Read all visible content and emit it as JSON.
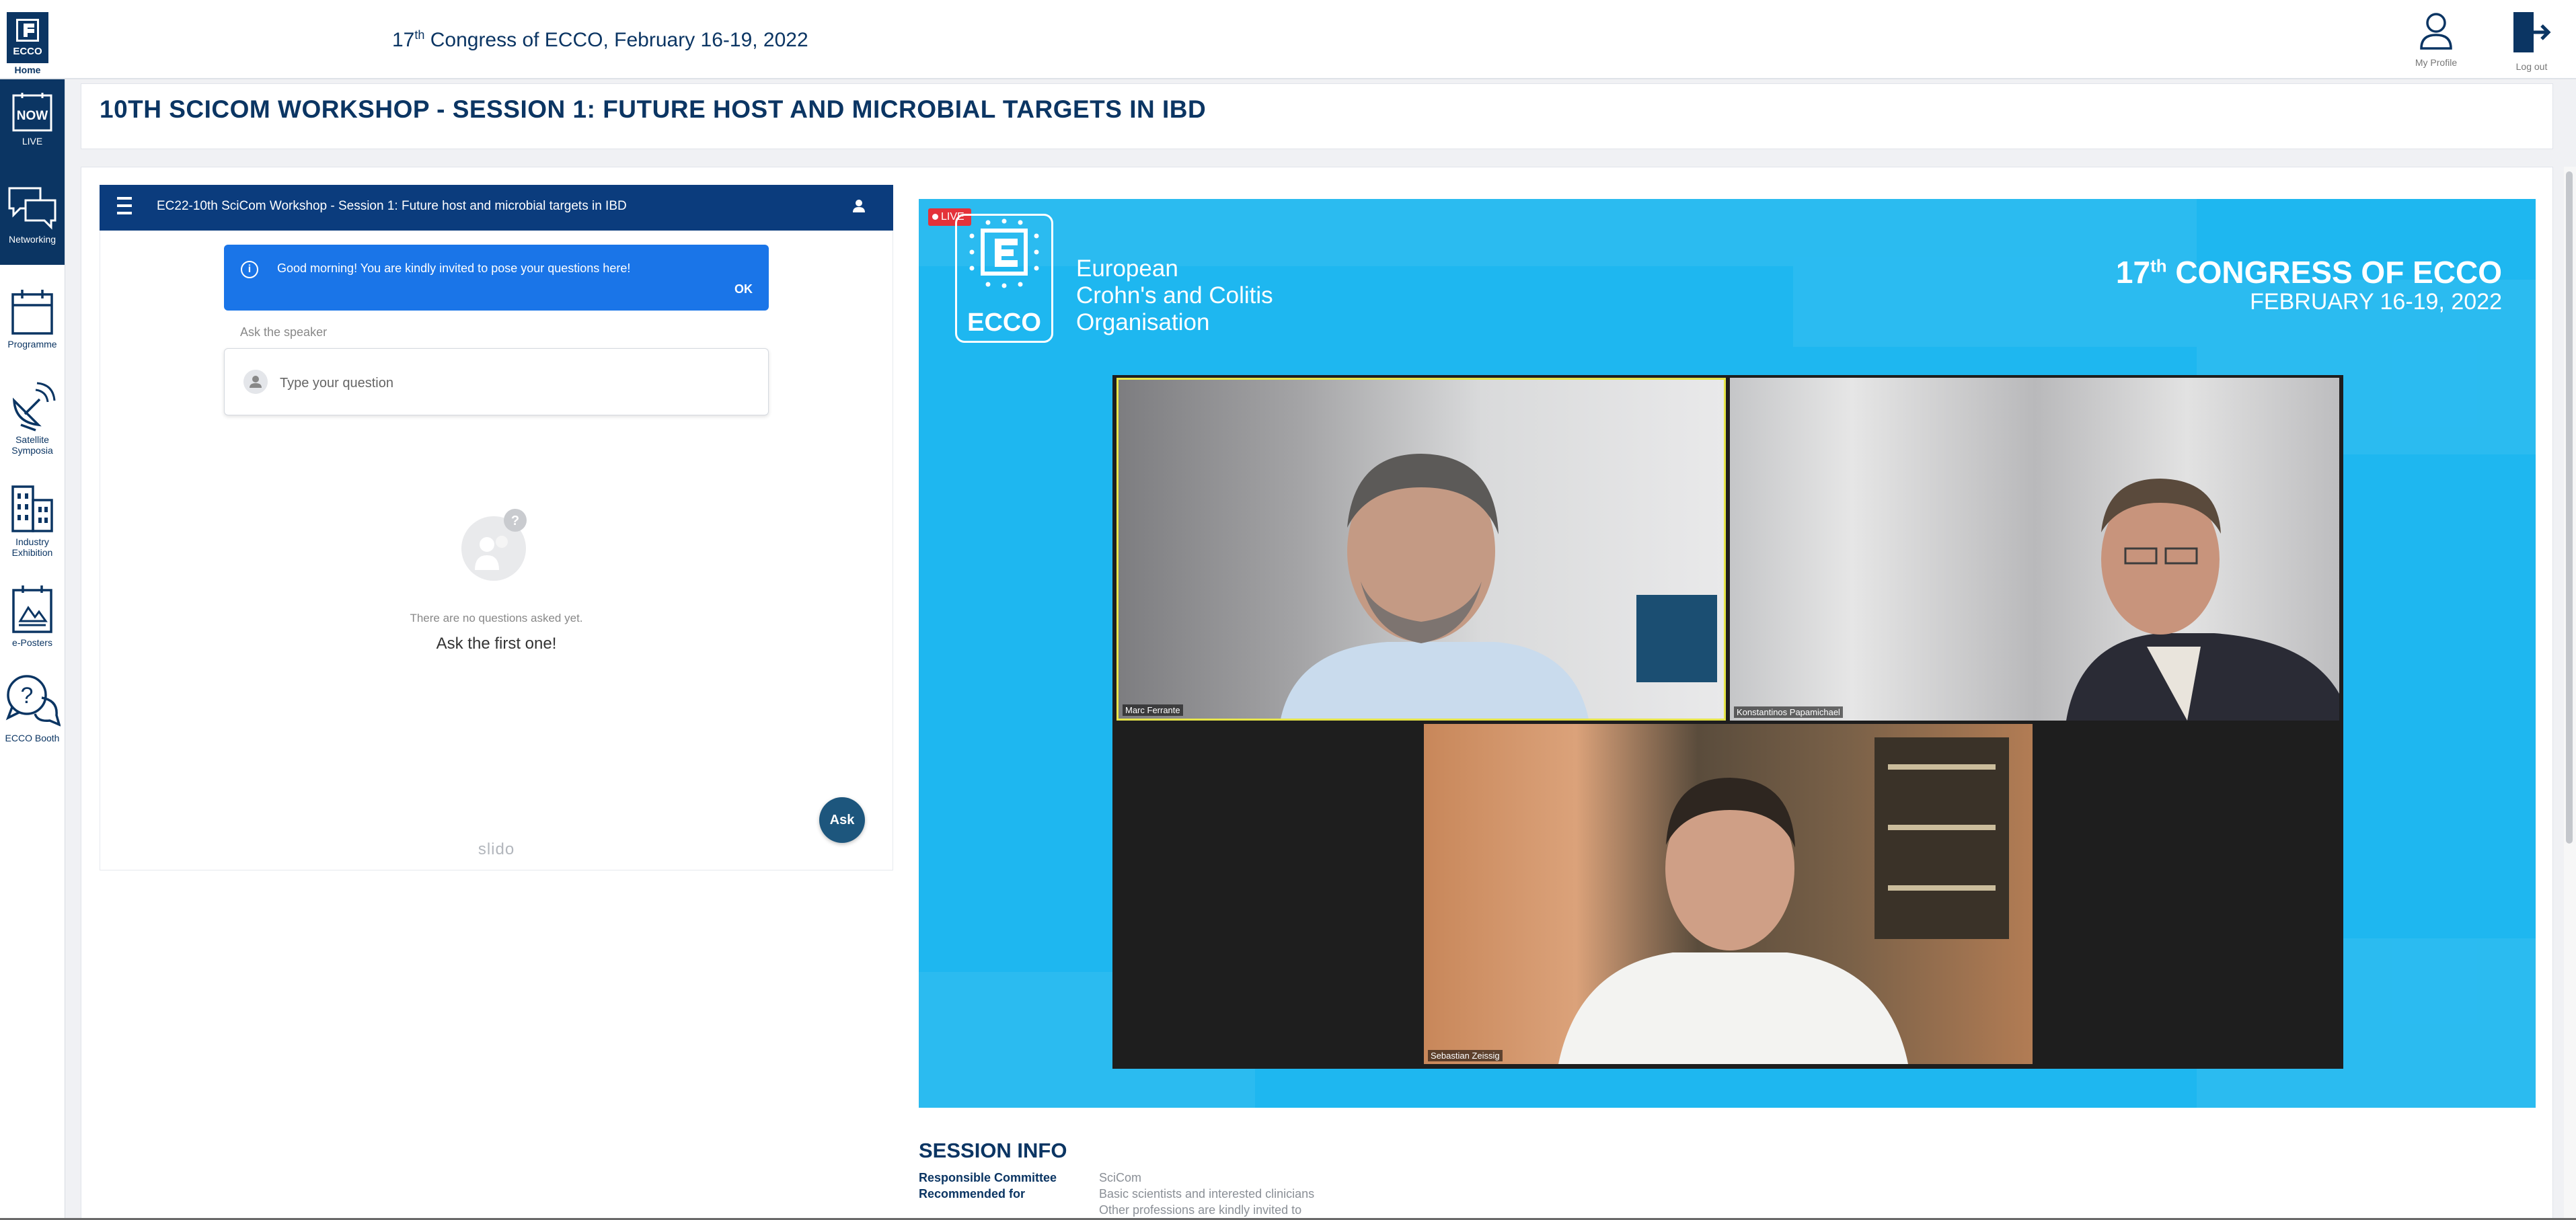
{
  "header": {
    "logo_text": "ECCO",
    "home_label": "Home",
    "congress_prefix": "17",
    "congress_sup": "th",
    "congress_rest": " Congress of ECCO, February 16-19, 2022",
    "profile_label": "My Profile",
    "logout_label": "Log out"
  },
  "sidebar": {
    "items": [
      {
        "label": "LIVE",
        "icon": "now-icon",
        "active": true
      },
      {
        "label": "Networking",
        "icon": "chat-bubbles-icon",
        "active": true
      },
      {
        "label": "Programme",
        "icon": "calendar-icon",
        "active": false
      },
      {
        "label": "Satellite Symposia",
        "icon": "satellite-dish-icon",
        "active": false
      },
      {
        "label": "Industry Exhibition",
        "icon": "buildings-icon",
        "active": false
      },
      {
        "label": "e-Posters",
        "icon": "poster-icon",
        "active": false
      },
      {
        "label": "ECCO Booth",
        "icon": "question-bubble-icon",
        "active": false
      }
    ],
    "now_text": "NOW"
  },
  "page": {
    "title": "10TH SCICOM WORKSHOP - SESSION 1: FUTURE HOST AND MICROBIAL TARGETS IN IBD"
  },
  "slido": {
    "title": "EC22-10th SciCom Workshop - Session 1: Future host and microbial targets in IBD",
    "banner_text": "Good morning! You are kindly invited to pose your questions here!",
    "banner_ok": "OK",
    "ask_speaker_label": "Ask the speaker",
    "question_placeholder": "Type your question",
    "empty_small": "There are no questions asked yet.",
    "empty_big": "Ask the first one!",
    "ask_button": "Ask",
    "brand": "slido"
  },
  "player": {
    "live_label": "LIVE",
    "logo_text": "ECCO",
    "org_line1": "European",
    "org_line2": "Crohn's and Colitis",
    "org_line3": "Organisation",
    "event_prefix": "17",
    "event_sup": "th",
    "event_rest": " CONGRESS OF ECCO",
    "event_dates": "FEBRUARY 16-19, 2022",
    "participants": [
      {
        "name": "Marc Ferrante"
      },
      {
        "name": "Konstantinos Papamichael"
      },
      {
        "name": "Sebastian Zeissig"
      }
    ]
  },
  "session_info": {
    "title": "SESSION INFO",
    "rows": [
      {
        "label": "Responsible Committee",
        "value": "SciCom"
      },
      {
        "label": "Recommended for",
        "value": "Basic scientists and interested clinicians"
      },
      {
        "label": "",
        "value": "Other professions are kindly invited to"
      }
    ]
  },
  "colors": {
    "brand_navy": "#0b3563",
    "player_blue": "#1eb7f0",
    "slido_header": "#0b3c7d",
    "banner_blue": "#1a75e8",
    "live_red": "#e4323a",
    "ask_button": "#1d567d"
  }
}
